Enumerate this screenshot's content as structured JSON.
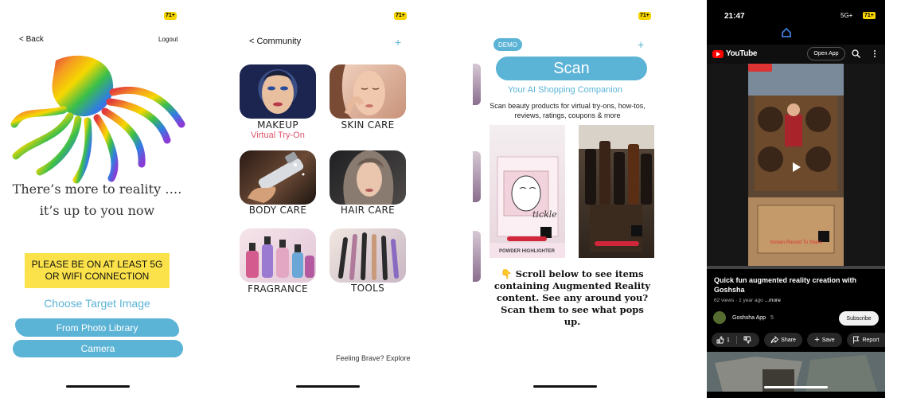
{
  "screen1": {
    "battery": "71+",
    "back_label": "< Back",
    "logout_label": "Logout",
    "tagline_line1": "There’s more to reality ….",
    "tagline_line2": "it’s up to you now",
    "warning": "PLEASE BE ON AT LEAST 5G OR WIFI CONNECTION",
    "choose_label": "Choose Target Image",
    "photo_library_label": "From Photo Library",
    "camera_label": "Camera"
  },
  "screen2": {
    "battery": "71+",
    "nav_label": "< Community",
    "plus_label": "+",
    "categories": [
      {
        "label": "MAKEUP",
        "sublabel": "Virtual Try-On"
      },
      {
        "label": "SKIN CARE",
        "sublabel": ""
      },
      {
        "label": "BODY CARE",
        "sublabel": ""
      },
      {
        "label": "HAIR CARE",
        "sublabel": ""
      },
      {
        "label": "FRAGRANCE",
        "sublabel": ""
      },
      {
        "label": "TOOLS",
        "sublabel": ""
      }
    ],
    "explore_label": "Feeling Brave? Explore"
  },
  "screen3": {
    "battery": "71+",
    "demo_label": "DEMO",
    "plus_label": "+",
    "scan_label": "Scan",
    "companion_label": "Your AI Shopping Companion",
    "description": "Scan beauty products for virtual try-ons, how-tos, reviews, ratings, coupons & more",
    "photo1_caption": "POWDER HIGHLIGHTER",
    "photo1_brand": "tickle",
    "scroll_text": "👇 Scroll below to see items containing Augmented Reality content. See any around you? Scan them to see what pops up."
  },
  "screen4": {
    "time": "21:47",
    "signal": "5G+",
    "battery": "71+",
    "brand": "YouTube",
    "open_app_label": "Open App",
    "video_overlay": "Screen Record To Share",
    "title": "Quick fun augmented reality creation with Goshsha",
    "views": "62 views · 1 year ago",
    "more_label": "...more",
    "channel_name": "Goshsha App",
    "channel_count": "5",
    "subscribe_label": "Subscribe",
    "like_count": "1",
    "share_label": "Share",
    "save_label": "Save",
    "report_label": "Report"
  },
  "colors": {
    "accent": "#5bb3d6",
    "warning_bg": "#fbe24a",
    "virtual_tryon": "#e0526b",
    "youtube_red": "#ff0000"
  }
}
